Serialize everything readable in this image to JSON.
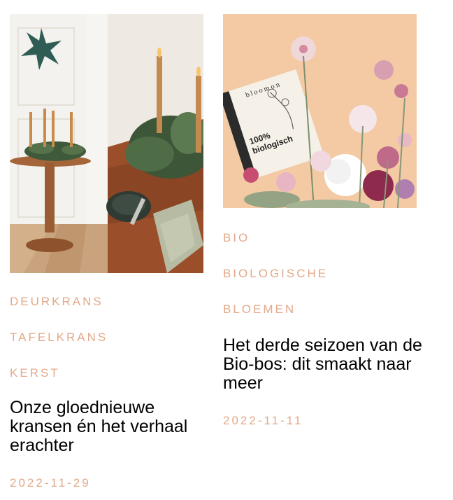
{
  "posts": [
    {
      "tags": [
        "DEURKRANS",
        "TAFELKRANS",
        "KERST"
      ],
      "title": "Onze gloednieuwe kransen én het verhaal erachter",
      "date": "2022-11-29",
      "image_icon": "wreath-photo"
    },
    {
      "tags": [
        "BIO",
        "BIOLOGISCHE",
        "BLOEMEN"
      ],
      "title": "Het derde seizoen van de Bio-bos: dit smaakt naar meer",
      "date": "2022-11-11",
      "image_icon": "flowers-photo",
      "image_text": {
        "brand": "bloomon",
        "line1": "100%",
        "line2": "biologisch"
      }
    }
  ],
  "colors": {
    "tag": "#e3a98a",
    "title": "#000000"
  }
}
